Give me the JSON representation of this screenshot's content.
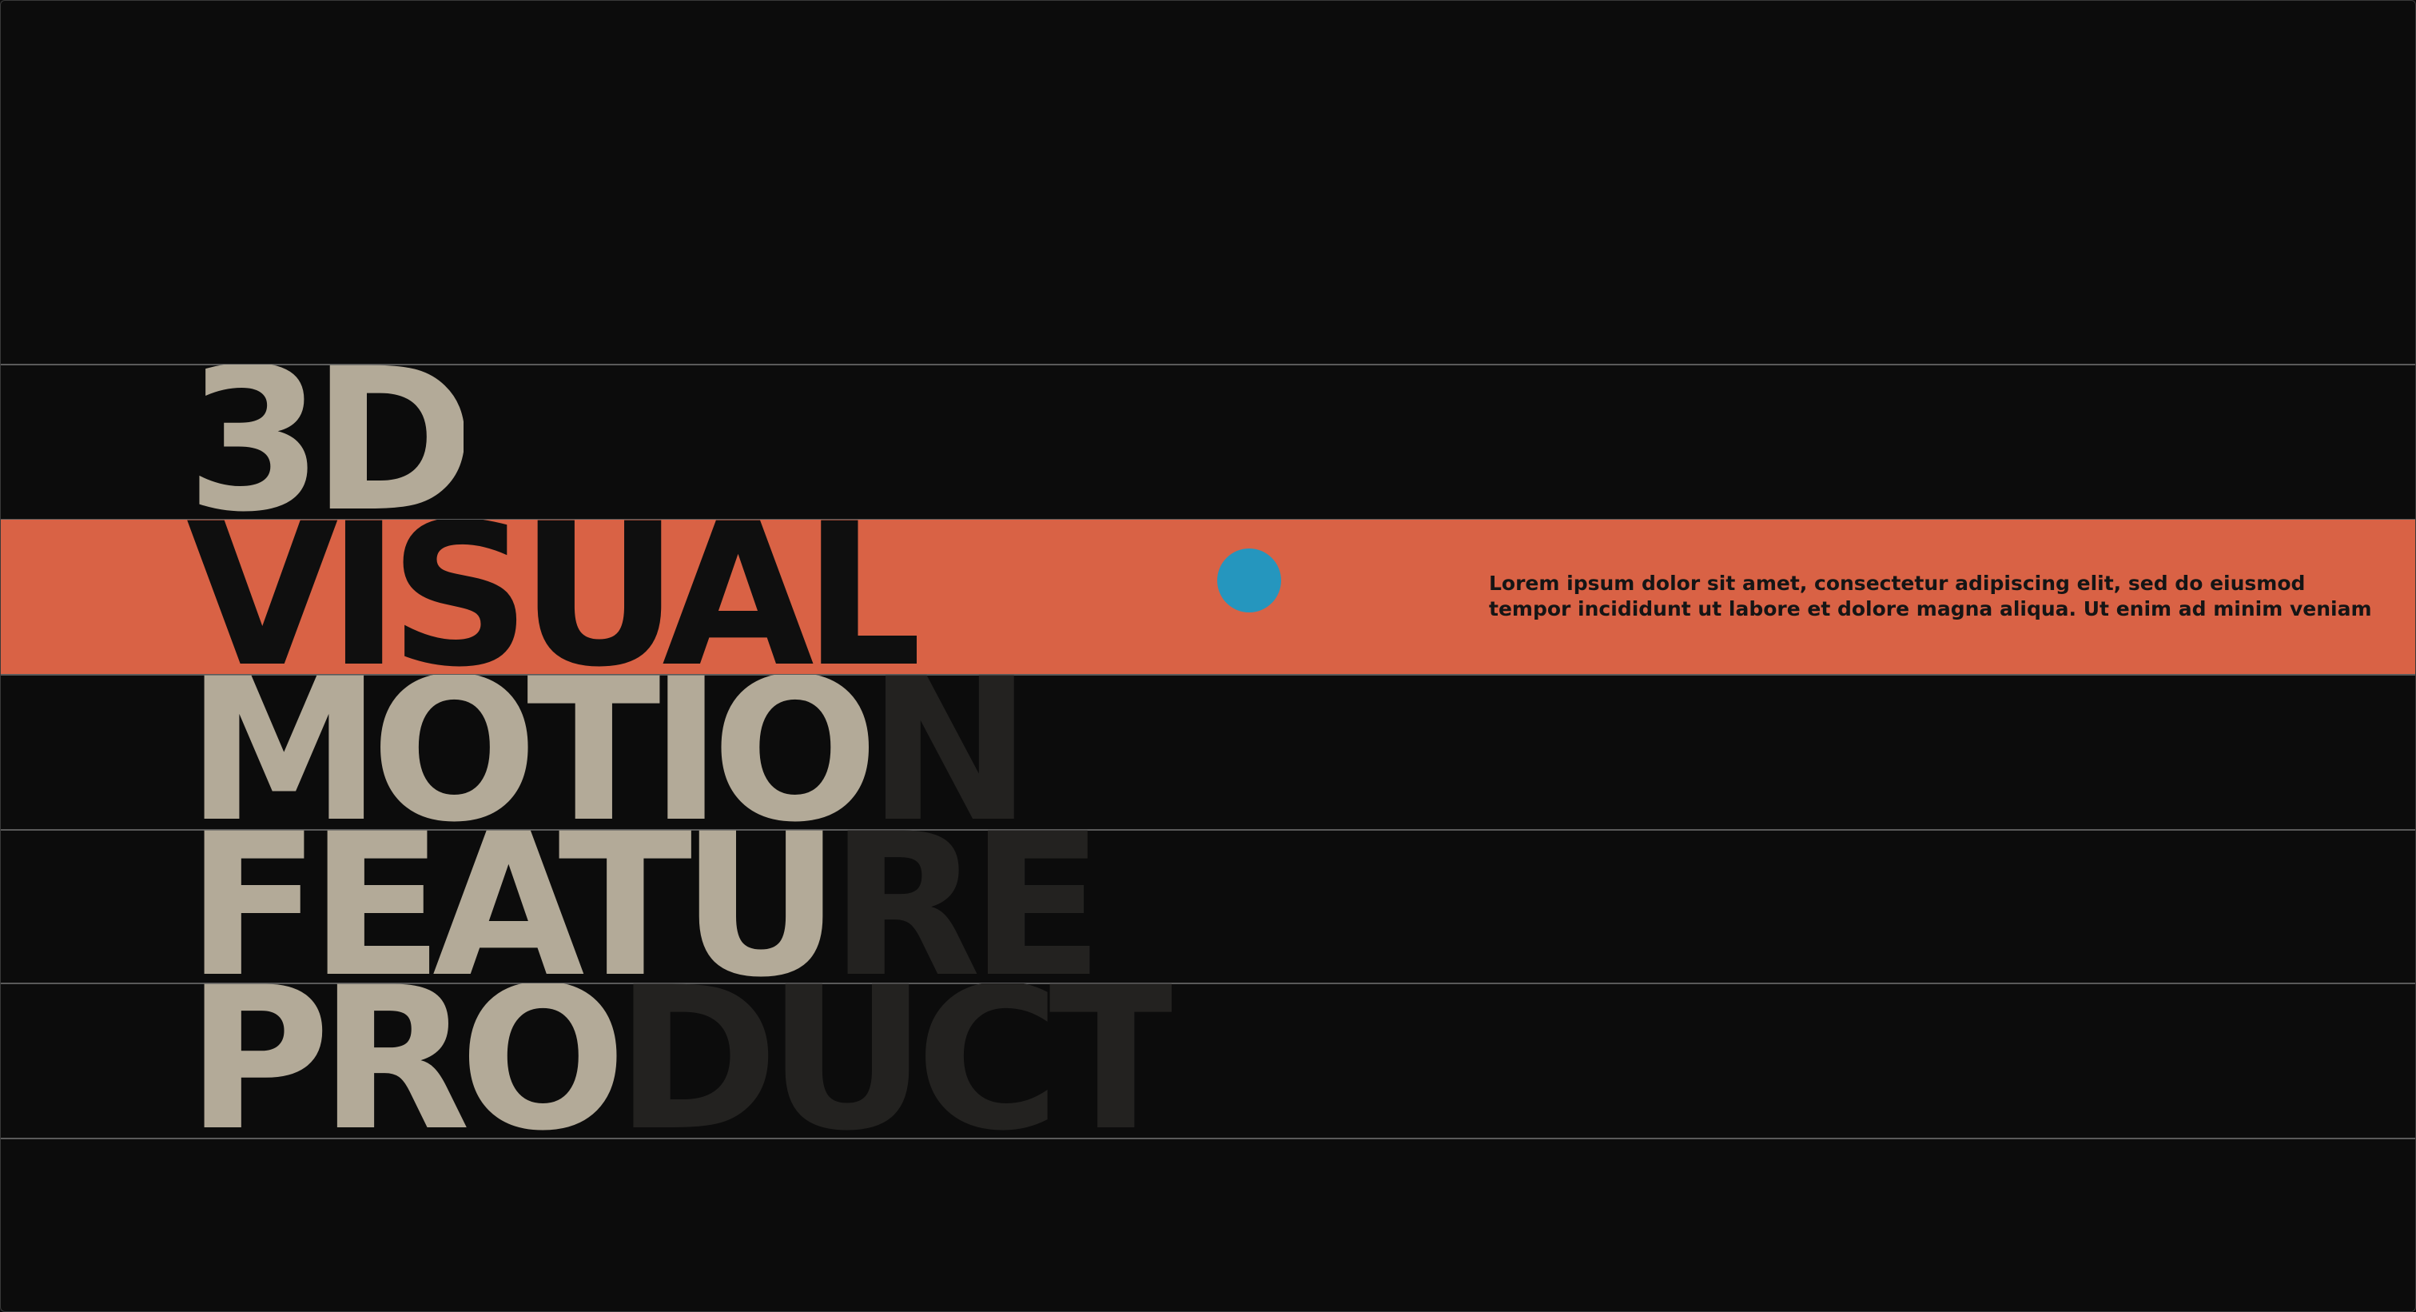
{
  "headline": {
    "lines": [
      {
        "solid": "3D",
        "faded": ""
      },
      {
        "solid": "VISUAL",
        "faded": ""
      },
      {
        "solid": "MOTIO",
        "faded": "N"
      },
      {
        "solid": "FEATU",
        "faded": "RE"
      },
      {
        "solid": "PRO",
        "faded": "DUCT"
      }
    ]
  },
  "highlight_band": {
    "dot_color": "#2596be",
    "caption_lines": [
      "Lorem ipsum dolor sit amet, consectetur adipiscing elit, sed do eiusmod",
      "tempor incididunt ut labore et dolore magna aliqua. Ut enim ad minim veniam"
    ]
  },
  "colors": {
    "background": "#0c0c0c",
    "band": "#d96245",
    "text_primary": "#b3aa98",
    "text_on_band": "#0f0f0f",
    "text_faded": "#232220"
  }
}
